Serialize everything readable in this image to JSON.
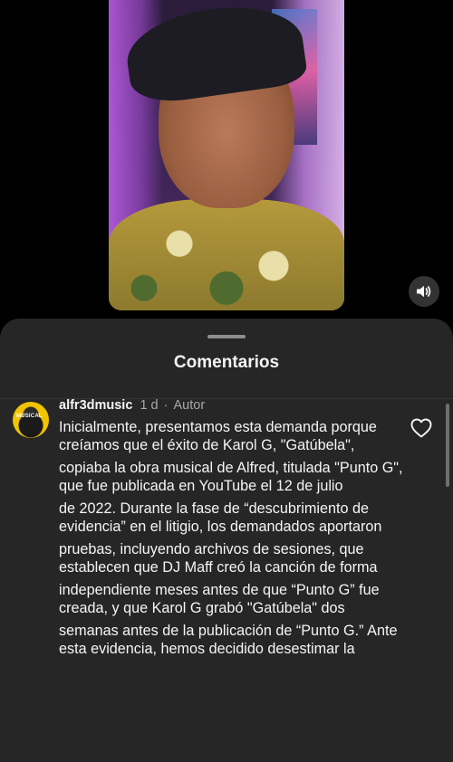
{
  "video": {
    "sound_icon": "speaker-icon"
  },
  "sheet": {
    "title": "Comentarios"
  },
  "comment": {
    "username": "alfr3dmusic",
    "age": "1 d",
    "separator": "·",
    "author_tag": "Autor",
    "avatar_label": "MUSICAL",
    "paragraphs": [
      "Inicialmente, presentamos esta demanda porque creíamos que el éxito de Karol G, \"Gatúbela\",",
      "copiaba la obra musical de Alfred, titulada \"Punto G\", que fue publicada en YouTube el 12 de julio",
      "de 2022. Durante la fase de “descubrimiento de evidencia” en el litigio, los demandados aportaron",
      "pruebas, incluyendo archivos de sesiones, que establecen que DJ Maff creó la canción de forma",
      "independiente meses antes de que “Punto G” fue creada, y que Karol G grabó \"Gatúbela\" dos",
      "semanas antes de la publicación de “Punto G.” Ante esta evidencia, hemos decidido desestimar la"
    ],
    "like_icon": "heart-icon"
  },
  "colors": {
    "sheet_bg": "#262626",
    "text_primary": "#f5f5f5",
    "text_secondary": "#a8a8a8"
  }
}
